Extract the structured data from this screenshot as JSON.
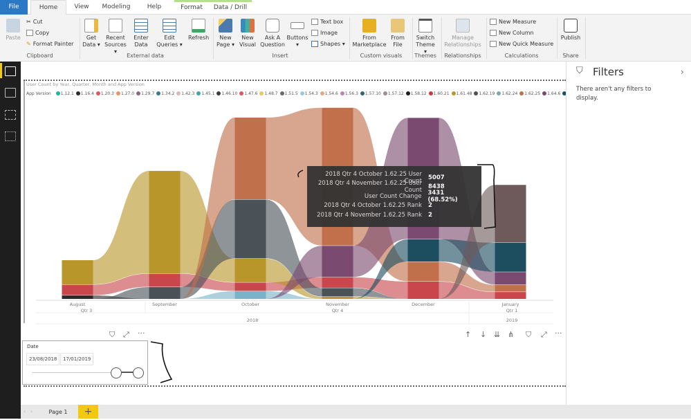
{
  "tabs": [
    {
      "label": "File"
    },
    {
      "label": "Home"
    },
    {
      "label": "View"
    },
    {
      "label": "Modeling"
    },
    {
      "label": "Help"
    },
    {
      "label": "Format"
    },
    {
      "label": "Data / Drill"
    }
  ],
  "ribbon": {
    "clipboard": {
      "paste": "Paste",
      "cut": "Cut",
      "copy": "Copy",
      "format_painter": "Format Painter",
      "group": "Clipboard"
    },
    "external": {
      "get_data": "Get Data ▾",
      "recent": "Recent Sources ▾",
      "enter": "Enter Data",
      "edit": "Edit Queries ▾",
      "refresh": "Refresh",
      "group": "External data"
    },
    "insert": {
      "new_page": "New Page ▾",
      "new_visual": "New Visual",
      "ask": "Ask A Question",
      "buttons": "Buttons ▾",
      "text_box": "Text box",
      "image": "Image",
      "shapes": "Shapes ▾",
      "group": "Insert"
    },
    "custom": {
      "marketplace": "From Marketplace",
      "file": "From File",
      "group": "Custom visuals"
    },
    "themes": {
      "switch": "Switch Theme ▾",
      "group": "Themes"
    },
    "relationships": {
      "manage": "Manage Relationships",
      "group": "Relationships"
    },
    "calculations": {
      "new_measure": "New Measure",
      "new_column": "New Column",
      "quick_measure": "New Quick Measure",
      "group": "Calculations"
    },
    "share": {
      "publish": "Publish",
      "group": "Share"
    }
  },
  "filters": {
    "title": "Filters",
    "empty": "There aren't any filters to display."
  },
  "pages": {
    "page1": "Page 1",
    "add": "+"
  },
  "slicer": {
    "title": "Date",
    "start": "23/08/2018",
    "end": "17/01/2019",
    "range": [
      0.82,
      1.0
    ]
  },
  "tooltip": [
    {
      "k": "2018 Qtr 4 October 1.62.25 User Count",
      "v": "5007"
    },
    {
      "k": "2018 Qtr 4 November 1.62.25 User Count",
      "v": "8438"
    },
    {
      "k": "User Count Change",
      "v": "3431 (68.52%)"
    },
    {
      "k": "2018 Qtr 4 October 1.62.25 Rank",
      "v": "2"
    },
    {
      "k": "2018 Qtr 4 November 1.62.25 Rank",
      "v": "2"
    }
  ],
  "chart_data": {
    "type": "ribbon",
    "title": "User Count by Year, Quarter, Month and App Version",
    "legend_title": "App Version",
    "legend_position": "top",
    "legend": [
      {
        "name": "1.12.1",
        "color": "#1fb5a0"
      },
      {
        "name": "1.16.4",
        "color": "#2b2b2b"
      },
      {
        "name": "1.20.3",
        "color": "#e0565c"
      },
      {
        "name": "1.27.0",
        "color": "#e8926a"
      },
      {
        "name": "1.29.7",
        "color": "#8a6a80"
      },
      {
        "name": "1.34.2",
        "color": "#3a7a8a"
      },
      {
        "name": "1.42.3",
        "color": "#d8bcbc"
      },
      {
        "name": "1.45.1",
        "color": "#3aaaa0"
      },
      {
        "name": "1.46.10",
        "color": "#3a3a3a"
      },
      {
        "name": "1.47.6",
        "color": "#d85a62"
      },
      {
        "name": "1.48.7",
        "color": "#e8c860"
      },
      {
        "name": "1.51.5",
        "color": "#666a6e"
      },
      {
        "name": "1.54.3",
        "color": "#9ac8dc"
      },
      {
        "name": "1.54.6",
        "color": "#e8a888"
      },
      {
        "name": "1.56.3",
        "color": "#b888b0"
      },
      {
        "name": "1.57.10",
        "color": "#2a6a6a"
      },
      {
        "name": "1.57.12",
        "color": "#9a9090"
      },
      {
        "name": "1.58.12",
        "color": "#1e1e1e"
      },
      {
        "name": "1.60.21",
        "color": "#c83a40"
      },
      {
        "name": "1.61.48",
        "color": "#b8962a"
      },
      {
        "name": "1.62.19",
        "color": "#4a5258"
      },
      {
        "name": "1.62.24",
        "color": "#7aa8b0"
      },
      {
        "name": "1.62.25",
        "color": "#c0704a"
      },
      {
        "name": "1.64.6",
        "color": "#7a4a70"
      },
      {
        "name": "1.67.4",
        "color": "#1d4e60"
      }
    ],
    "categories": [
      "August",
      "September",
      "October",
      "November",
      "December",
      "January"
    ],
    "quarters": [
      {
        "label": "Qtr 3"
      },
      {
        "label": "Qtr 4"
      },
      {
        "label": "Qtr 1"
      }
    ],
    "years": [
      {
        "label": "2018"
      },
      {
        "label": "2019"
      }
    ],
    "series": [
      {
        "name": "1.16.4",
        "color": "#2b2b2b",
        "values": [
          210,
          0,
          0,
          0,
          0,
          0
        ]
      },
      {
        "name": "1.47.6",
        "color": "#c8464c",
        "values": [
          640,
          800,
          510,
          640,
          1060,
          420
        ]
      },
      {
        "name": "1.61.48",
        "color": "#b8962a",
        "values": [
          1480,
          6280,
          1440,
          130,
          0,
          0
        ]
      },
      {
        "name": "1.62.19",
        "color": "#4a5258",
        "values": [
          0,
          720,
          3600,
          510,
          0,
          0
        ]
      },
      {
        "name": "1.54.3",
        "color": "#7ab3c8",
        "values": [
          0,
          0,
          470,
          0,
          0,
          0
        ]
      },
      {
        "name": "1.62.25",
        "color": "#c0704a",
        "values": [
          0,
          0,
          5007,
          8438,
          1190,
          420
        ]
      },
      {
        "name": "1.64.6",
        "color": "#7a4a70",
        "values": [
          0,
          0,
          0,
          1910,
          7420,
          760
        ]
      },
      {
        "name": "1.67.4",
        "color": "#1d4e60",
        "values": [
          0,
          0,
          0,
          0,
          1360,
          1780
        ]
      },
      {
        "name": "1.57.12",
        "color": "#6e5a5a",
        "values": [
          0,
          0,
          0,
          0,
          0,
          3520
        ]
      }
    ]
  }
}
